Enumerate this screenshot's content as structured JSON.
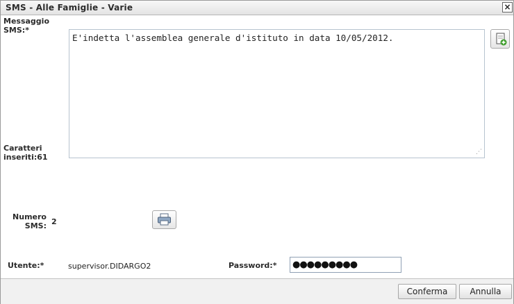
{
  "dialog": {
    "title": "SMS - Alle Famiglie - Varie",
    "close_label": "×"
  },
  "message": {
    "label_line1": "Messaggio",
    "label_line2": "SMS:*",
    "text": "E'indetta l'assemblea generale d'istituto in data 10/05/2012.",
    "chars_label_line1": "Caratteri",
    "chars_label_line2": "inseriti:61",
    "add_icon": "add-document-icon"
  },
  "sms_count": {
    "label_line1": "Numero",
    "label_line2": "SMS:",
    "value": "2",
    "print_icon": "printer-icon"
  },
  "credentials": {
    "user_label": "Utente:*",
    "user_value": "supervisor.DIDARGO2",
    "password_label": "Password:*",
    "password_value": "●●●●●●●●●"
  },
  "footer": {
    "confirm_label": "Conferma",
    "cancel_label": "Annulla"
  }
}
